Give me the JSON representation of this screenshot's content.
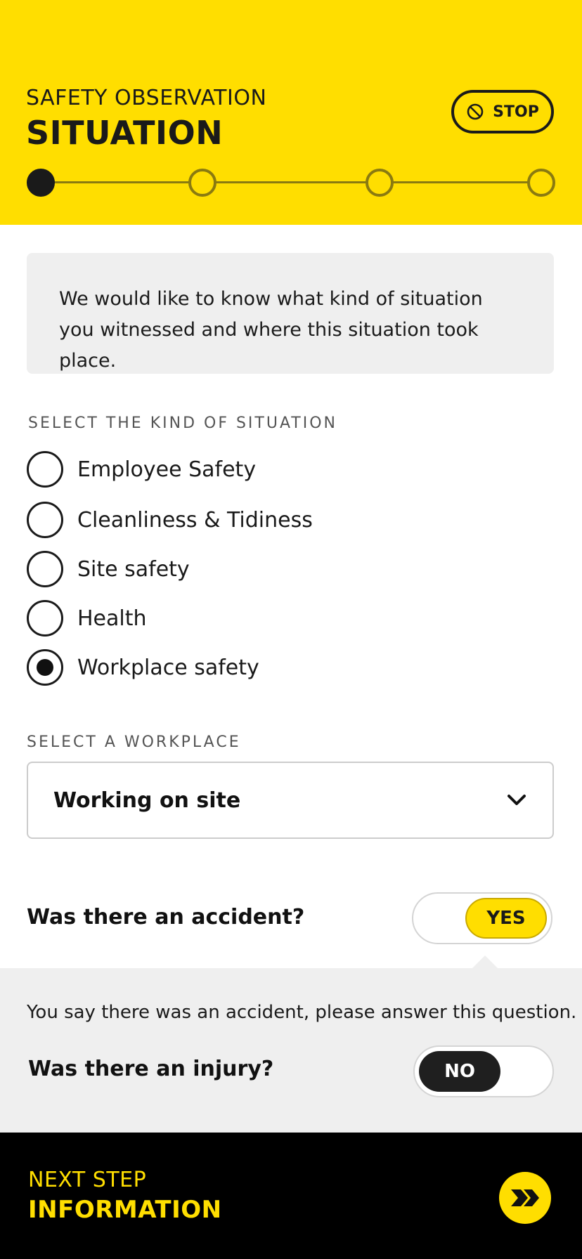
{
  "header": {
    "eyebrow": "SAFETY OBSERVATION",
    "title": "SITUATION",
    "stop_label": "STOP",
    "progress": {
      "total_steps": 4,
      "current_step": 1
    }
  },
  "intro": {
    "text": "We would like to know what kind of situation you witnessed and where this situation took place."
  },
  "situation": {
    "label": "SELECT THE KIND OF SITUATION",
    "options": [
      {
        "label": "Employee Safety",
        "selected": false
      },
      {
        "label": "Cleanliness & Tidiness",
        "selected": false
      },
      {
        "label": "Site safety",
        "selected": false
      },
      {
        "label": "Health",
        "selected": false
      },
      {
        "label": "Workplace safety",
        "selected": true
      }
    ]
  },
  "workplace": {
    "label": "SELECT A WORKPLACE",
    "selected_value": "Working on site"
  },
  "accident": {
    "question": "Was there an accident?",
    "answer": "YES"
  },
  "followup": {
    "note": "You say there was an accident, please answer this question.",
    "question": "Was there an injury?",
    "answer": "NO"
  },
  "footer": {
    "eyebrow": "NEXT STEP",
    "title": "INFORMATION"
  },
  "colors": {
    "brand_yellow": "#FFDE00",
    "dark": "#1a1a1a",
    "panel_gray": "#efefef"
  },
  "icons": {
    "stop": "prohibited-icon",
    "dropdown": "chevron-down-icon",
    "next": "double-chevron-right-icon"
  }
}
